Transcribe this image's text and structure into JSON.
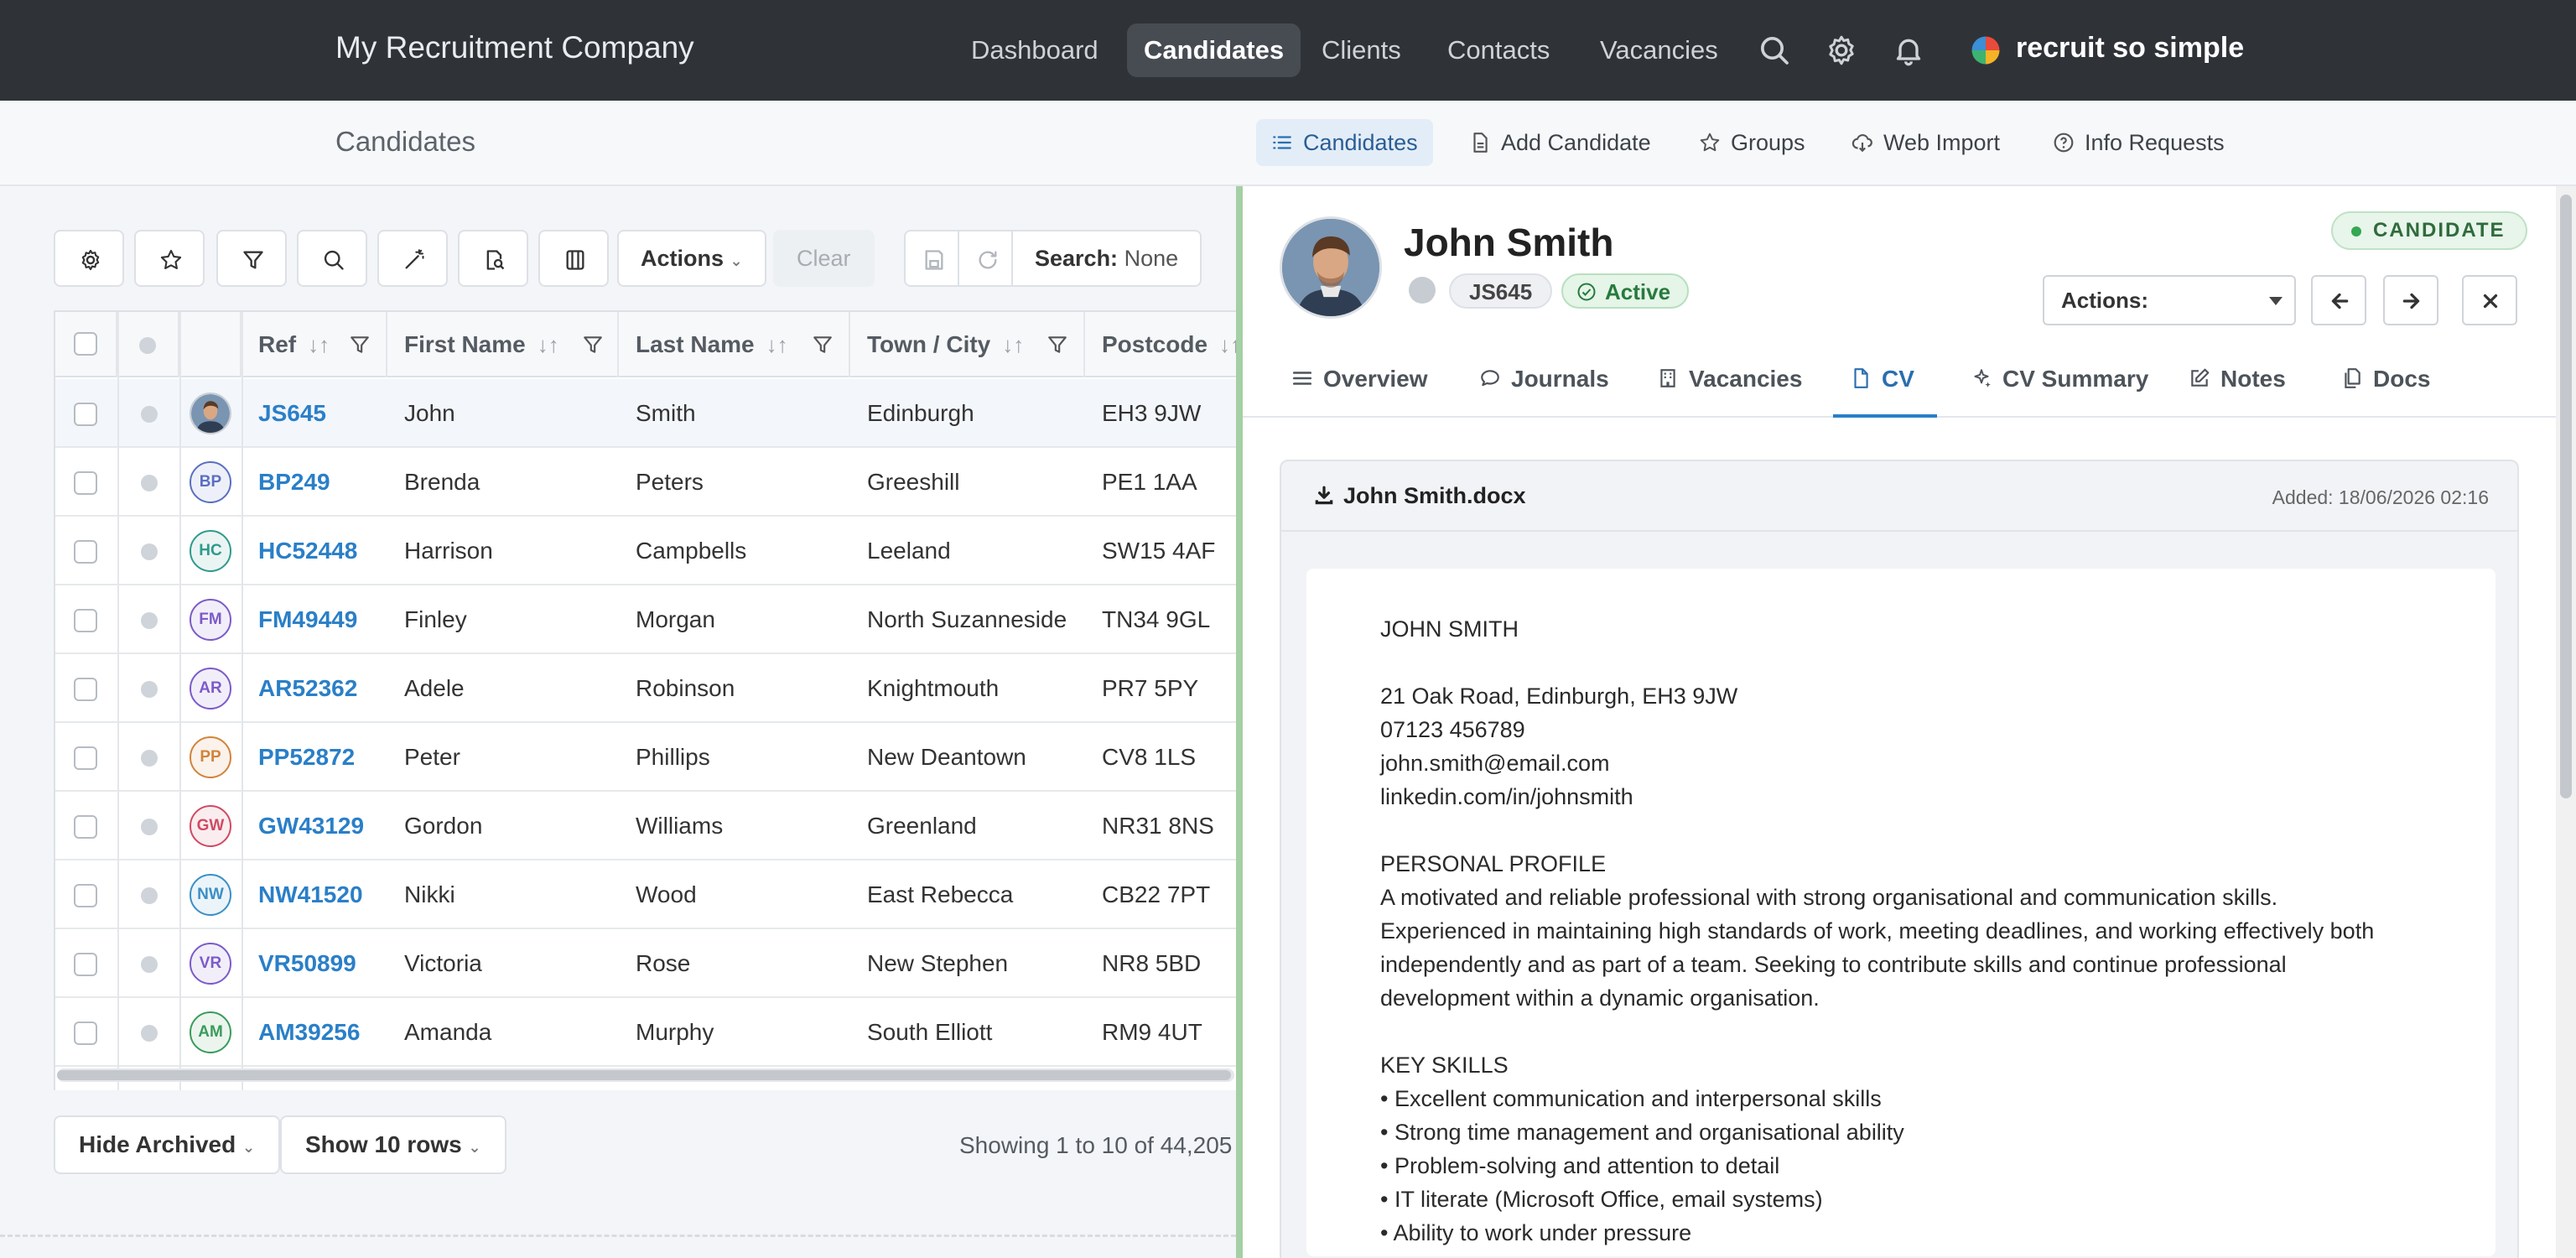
{
  "app": {
    "company": "My Recruitment Company",
    "logo_text": "recruit so simple"
  },
  "topnav": {
    "items": [
      "Dashboard",
      "Candidates",
      "Clients",
      "Contacts",
      "Vacancies"
    ],
    "active": "Candidates"
  },
  "subbar": {
    "title": "Candidates",
    "items": [
      "Candidates",
      "Add Candidate",
      "Groups",
      "Web Import",
      "Info Requests"
    ]
  },
  "toolbar": {
    "actions_label": "Actions",
    "clear_label": "Clear",
    "search_prefix": "Search:",
    "search_value": "None"
  },
  "table": {
    "columns": [
      "Ref",
      "First Name",
      "Last Name",
      "Town / City",
      "Postcode"
    ],
    "rows": [
      {
        "initials": "",
        "ref": "JS645",
        "first": "John",
        "last": "Smith",
        "town": "Edinburgh",
        "postcode": "EH3 9JW",
        "color": "#3b6fa8"
      },
      {
        "initials": "BP",
        "ref": "BP249",
        "first": "Brenda",
        "last": "Peters",
        "town": "Greeshill",
        "postcode": "PE1 1AA",
        "color": "#5b6fc0"
      },
      {
        "initials": "HC",
        "ref": "HC52448",
        "first": "Harrison",
        "last": "Campbells",
        "town": "Leeland",
        "postcode": "SW15 4AF",
        "color": "#2f9a8c"
      },
      {
        "initials": "FM",
        "ref": "FM49449",
        "first": "Finley",
        "last": "Morgan",
        "town": "North Suzanneside",
        "postcode": "TN34 9GL",
        "color": "#7b5bc9"
      },
      {
        "initials": "AR",
        "ref": "AR52362",
        "first": "Adele",
        "last": "Robinson",
        "town": "Knightmouth",
        "postcode": "PR7 5PY",
        "color": "#7b5bc9"
      },
      {
        "initials": "PP",
        "ref": "PP52872",
        "first": "Peter",
        "last": "Phillips",
        "town": "New Deantown",
        "postcode": "CV8 1LS",
        "color": "#d2843a"
      },
      {
        "initials": "GW",
        "ref": "GW43129",
        "first": "Gordon",
        "last": "Williams",
        "town": "Greenland",
        "postcode": "NR31 8NS",
        "color": "#d04a64"
      },
      {
        "initials": "NW",
        "ref": "NW41520",
        "first": "Nikki",
        "last": "Wood",
        "town": "East Rebecca",
        "postcode": "CB22 7PT",
        "color": "#3a8fc6"
      },
      {
        "initials": "VR",
        "ref": "VR50899",
        "first": "Victoria",
        "last": "Rose",
        "town": "New Stephen",
        "postcode": "NR8 5BD",
        "color": "#7b5bc9"
      },
      {
        "initials": "AM",
        "ref": "AM39256",
        "first": "Amanda",
        "last": "Murphy",
        "town": "South Elliott",
        "postcode": "RM9 4UT",
        "color": "#3a9b5c"
      }
    ]
  },
  "footer": {
    "archived_label": "Hide Archived",
    "rows_label": "Show 10 rows",
    "info": "Showing 1 to 10 of 44,205"
  },
  "candidate": {
    "name": "John Smith",
    "ref": "JS645",
    "status": "Active",
    "badge": "CANDIDATE",
    "actions_label": "Actions:",
    "tabs": [
      "Overview",
      "Journals",
      "Vacancies",
      "CV",
      "CV Summary",
      "Notes",
      "Docs"
    ],
    "active_tab": "CV",
    "file_name": "John Smith.docx",
    "added": "Added: 18/06/2026 02:16"
  },
  "cv": {
    "lines": [
      "JOHN SMITH",
      "",
      "21 Oak Road, Edinburgh, EH3 9JW",
      "07123 456789",
      "john.smith@email.com",
      "linkedin.com/in/johnsmith",
      "",
      "PERSONAL PROFILE",
      "A motivated and reliable professional with strong organisational and communication skills.",
      "Experienced in maintaining high standards of work, meeting deadlines, and working effectively both",
      "independently and as part of a team. Seeking to contribute skills and continue professional",
      "development within a dynamic organisation.",
      "",
      "KEY SKILLS",
      "• Excellent communication and interpersonal skills",
      "• Strong time management and organisational ability",
      "• Problem-solving and attention to detail",
      "• IT literate (Microsoft Office, email systems)",
      "• Ability to work under pressure"
    ]
  },
  "colors": {
    "nav_bg": "#2f3338",
    "accent": "#2a7fc8",
    "active_green": "#277a3d"
  }
}
